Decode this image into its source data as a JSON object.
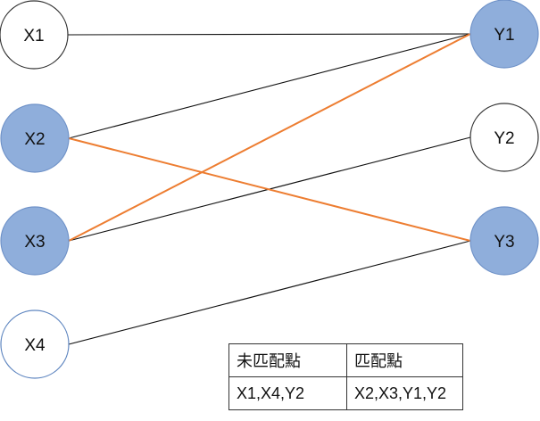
{
  "graph": {
    "nodes": [
      {
        "id": "X1",
        "label": "X1",
        "side": "left",
        "matched": false
      },
      {
        "id": "X2",
        "label": "X2",
        "side": "left",
        "matched": true
      },
      {
        "id": "X3",
        "label": "X3",
        "side": "left",
        "matched": true
      },
      {
        "id": "X4",
        "label": "X4",
        "side": "left",
        "matched": false
      },
      {
        "id": "Y1",
        "label": "Y1",
        "side": "right",
        "matched": true
      },
      {
        "id": "Y2",
        "label": "Y2",
        "side": "right",
        "matched": false
      },
      {
        "id": "Y3",
        "label": "Y3",
        "side": "right",
        "matched": true
      }
    ],
    "edges": [
      {
        "from": "X1",
        "to": "Y1",
        "matching": false
      },
      {
        "from": "X2",
        "to": "Y1",
        "matching": false
      },
      {
        "from": "X3",
        "to": "Y2",
        "matching": false
      },
      {
        "from": "X4",
        "to": "Y3",
        "matching": false
      },
      {
        "from": "X2",
        "to": "Y3",
        "matching": true
      },
      {
        "from": "X3",
        "to": "Y1",
        "matching": true
      }
    ]
  },
  "colors": {
    "matched_fill": "#8faedb",
    "matched_stroke": "#6f92c8",
    "unmatched_fill": "#ffffff",
    "unmatched_stroke": "#333333",
    "x4_stroke": "#5f86c0",
    "edge": "#111111",
    "matching_edge": "#ed7d31"
  },
  "table": {
    "header_unmatched": "未匹配點",
    "header_matched": "匹配點",
    "unmatched_points": "X1,X4,Y2",
    "matched_points": "X2,X3,Y1,Y2"
  }
}
